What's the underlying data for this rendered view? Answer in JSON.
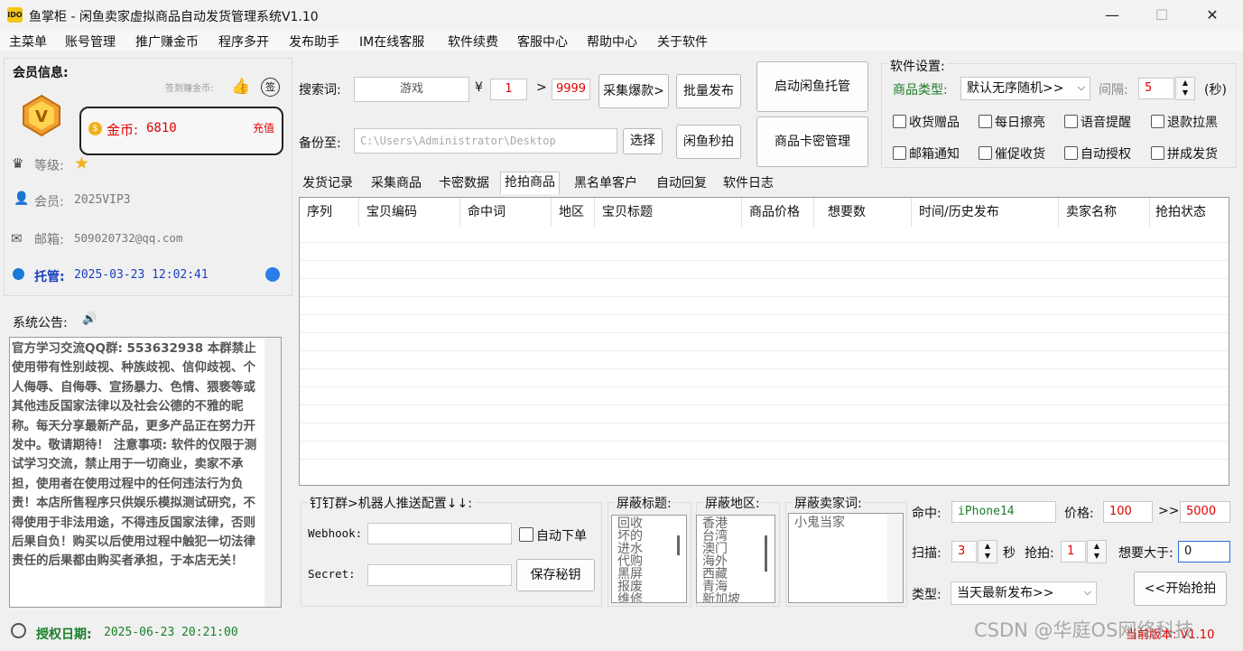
{
  "window": {
    "app_logo": "IDO",
    "title": "鱼掌柜 - 闲鱼卖家虚拟商品自动发货管理系统V1.10",
    "minimize": "—",
    "maximize": "☐",
    "close": "✕"
  },
  "menu": [
    "主菜单",
    "账号管理",
    "推广赚金币",
    "程序多开",
    "发布助手",
    "IM在线客服",
    "软件续费",
    "客服中心",
    "帮助中心",
    "关于软件"
  ],
  "member": {
    "section_title": "会员信息:",
    "signin_text": "签到赚金币:",
    "sign_badge": "签",
    "coins_label": "金币:",
    "coins_value": "6810",
    "recharge": "充值",
    "level_label": "等级:",
    "member_label": "会员:",
    "member_value": "2025VIP3",
    "email_label": "邮箱:",
    "email_value": "509020732@qq.com",
    "hosting_label": "托管:",
    "hosting_value": "2025-03-23 12:02:41"
  },
  "notice": {
    "title": "系统公告:",
    "text": "官方学习交流QQ群: 553632938 本群禁止使用带有性别歧视、种族歧视、信仰歧视、个人侮辱、自侮辱、宣扬暴力、色情、猥亵等或其他违反国家法律以及社会公德的不雅的昵称。每天分享最新产品，更多产品正在努力开发中。敬请期待！ 注意事项: 软件的仅限于测试学习交流，禁止用于一切商业，卖家不承担，使用者在使用过程中的任何违法行为负责！本店所售程序只供娱乐模拟测试研究，不得使用于非法用途，不得违反国家法律，否则后果自负！购买以后使用过程中触犯一切法律责任的后果都由购买者承担，于本店无关！"
  },
  "search": {
    "keyword_label": "搜索词:",
    "keyword_value": "游戏",
    "currency": "¥",
    "price_min": "1",
    "arrow": ">",
    "price_max": "9999",
    "collect_button": "采集爆款>",
    "batch_publish_button": "批量发布",
    "backup_label": "备份至:",
    "backup_path": "C:\\Users\\Administrator\\Desktop",
    "choose_button": "选择",
    "flash_button": "闲鱼秒拍",
    "start_hosting_button": "启动闲鱼托管",
    "card_manage_button": "商品卡密管理"
  },
  "settings": {
    "title": "软件设置:",
    "type_label": "商品类型:",
    "type_value": "默认无序随机>>",
    "interval_label": "间隔:",
    "interval_value": "5",
    "interval_unit": "(秒)",
    "checkboxes": [
      "收货赠品",
      "每日擦亮",
      "语音提醒",
      "退款拉黑",
      "邮箱通知",
      "催促收货",
      "自动授权",
      "拼成发货"
    ]
  },
  "tabs": [
    "发货记录",
    "采集商品",
    "卡密数据",
    "抢拍商品",
    "黑名单客户",
    "自动回复",
    "软件日志"
  ],
  "table": {
    "columns": [
      "序列",
      "宝贝编码",
      "命中词",
      "地区",
      "宝贝标题",
      "商品价格",
      "想要数",
      "时间/历史发布",
      "卖家名称",
      "抢拍状态"
    ]
  },
  "dingtalk": {
    "title": "钉钉群>机器人推送配置↓↓:",
    "webhook_label": "Webhook:",
    "webhook_value": "",
    "auto_order_label": "自动下单",
    "secret_label": "Secret:",
    "secret_value": "",
    "save_button": "保存秘钥"
  },
  "block_title": {
    "title": "屏蔽标题:",
    "items": [
      "回收",
      "坏的",
      "进水",
      "代购",
      "黑屏",
      "报废",
      "维修"
    ]
  },
  "block_region": {
    "title": "屏蔽地区:",
    "items": [
      "香港",
      "台湾",
      "澳门",
      "海外",
      "西藏",
      "青海",
      "新加坡"
    ]
  },
  "block_seller": {
    "title": "屏蔽卖家词:",
    "items": [
      "小鬼当家"
    ]
  },
  "snipe": {
    "hit_label": "命中:",
    "hit_value": "iPhone14",
    "price_label": "价格:",
    "price_min": "100",
    "range_sep": ">>",
    "price_max": "5000",
    "scan_label": "扫描:",
    "scan_value": "3",
    "scan_unit": "秒",
    "grab_label": "抢拍:",
    "grab_value": "1",
    "want_label": "想要大于:",
    "want_value": "0",
    "type_label": "类型:",
    "type_value": "当天最新发布>>",
    "start_button": "<<开始抢拍"
  },
  "status": {
    "auth_label": "授权日期:",
    "auth_value": "2025-06-23 20:21:00",
    "version_text": "当前版本: V1.10",
    "watermark": "CSDN @华庭OS网络科技"
  },
  "colors": {
    "accent_red": "#e00000",
    "accent_green": "#1a7f2a",
    "accent_blue": "#1a3fbf"
  }
}
